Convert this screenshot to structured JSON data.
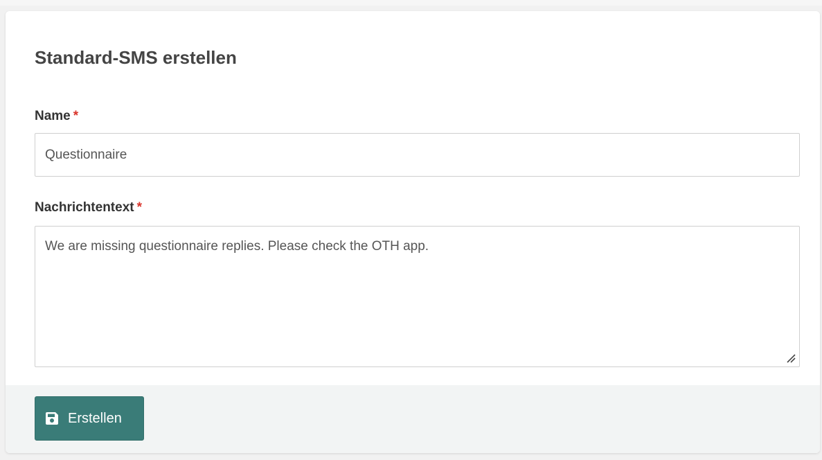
{
  "form": {
    "title": "Standard-SMS erstellen",
    "name_label": "Name",
    "name_required_mark": "*",
    "name_value": "Questionnaire",
    "message_label": "Nachrichtentext",
    "message_required_mark": "*",
    "message_value": "We are missing questionnaire replies. Please check the OTH app.",
    "submit_label": "Erstellen",
    "submit_icon": "floppy-disk-icon"
  },
  "colors": {
    "button_bg": "#3a7c78",
    "required_mark": "#d9342b",
    "footer_bg": "#f2f4f4"
  }
}
